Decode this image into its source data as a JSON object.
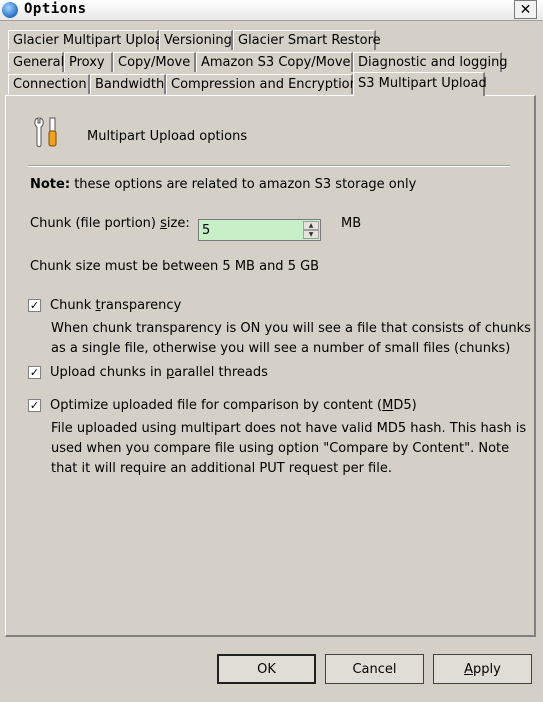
{
  "window": {
    "title": "Options",
    "close_glyph": "✕"
  },
  "tabs_row1": [
    "Glacier Multipart Upload",
    "Versioning",
    "Glacier Smart Restore"
  ],
  "tabs_row2": [
    "General",
    "Proxy",
    "Copy/Move",
    "Amazon S3 Copy/Move",
    "Diagnostic and logging"
  ],
  "tabs_row3": [
    "Connection",
    "Bandwidth",
    "Compression and Encryption",
    "S3 Multipart Upload"
  ],
  "active_tab": "S3 Multipart Upload",
  "panel": {
    "header_icon": "tools-icon",
    "header": "Multipart Upload options",
    "note_label": "Note:",
    "note_text": "these options are related to amazon S3 storage only",
    "chunk_size_label": "Chunk (file portion) size:",
    "chunk_size_value": "5",
    "chunk_size_unit": "MB",
    "chunk_hint": "Chunk size must be between 5 MB and 5 GB",
    "options": [
      {
        "label": "Chunk transparency",
        "checked": true,
        "description_lines": [
          "When chunk transparency is ON you will see a file that consists of chunks",
          "as a single file, otherwise you will see a number of small files (chunks)"
        ]
      },
      {
        "label": "Upload chunks in parallel threads",
        "checked": true,
        "description_lines": []
      },
      {
        "label": "Optimize uploaded file for comparison by content (MD5)",
        "checked": true,
        "description_lines": [
          "File uploaded using multipart does not have valid MD5 hash. This hash is",
          "used when you compare file using option \"Compare by Content\". Note",
          "that it will require an additional PUT request per file."
        ]
      }
    ]
  },
  "buttons": {
    "ok": "OK",
    "cancel": "Cancel",
    "apply": "Apply"
  },
  "colors": {
    "dialog_bg": "#d4d0c8",
    "spinner_bg": "#c8f0c8"
  }
}
